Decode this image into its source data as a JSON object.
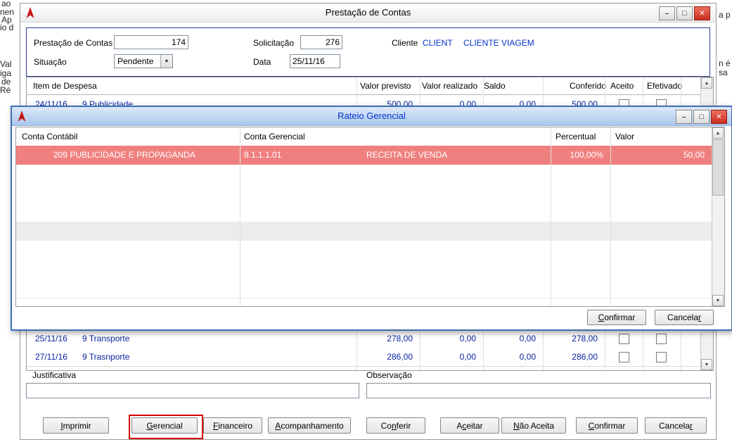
{
  "fragments": {
    "left": [
      "ao",
      "nen",
      "Ap",
      "io d",
      "Val",
      "iga",
      "de",
      "Ré"
    ],
    "right": [
      "a p",
      "n é",
      "sa"
    ]
  },
  "main_window": {
    "title": "Prestação de Contas",
    "form": {
      "prestacao_label": "Prestação de Contas",
      "prestacao_value": "174",
      "solicitacao_label": "Solicitação",
      "solicitacao_value": "276",
      "cliente_label": "Cliente",
      "cliente_code": "CLIENT",
      "cliente_name": "CLIENTE VIAGEM",
      "situacao_label": "Situação",
      "situacao_value": "Pendente",
      "data_label": "Data",
      "data_value": "25/11/16"
    },
    "table": {
      "headers": [
        "Item de Despesa",
        "Valor previsto",
        "Valor realizado",
        "Saldo",
        "Conferido",
        "Aceito",
        "Efetivado"
      ],
      "partial_row": {
        "date": "24/11/16",
        "item": "9 Publicidade",
        "previsto": "500,00",
        "realizado": "0,00",
        "saldo": "0,00",
        "conferido": "500,00"
      },
      "rows": [
        {
          "date": "25/11/16",
          "item": "9 Transporte",
          "previsto": "278,00",
          "realizado": "0,00",
          "saldo": "0,00",
          "conferido": "278,00",
          "aceito": false,
          "efetivado": false
        },
        {
          "date": "27/11/16",
          "item": "9 Trasnporte",
          "previsto": "286,00",
          "realizado": "0,00",
          "saldo": "0,00",
          "conferido": "286,00",
          "aceito": false,
          "efetivado": false
        }
      ]
    },
    "justificativa_label": "Justificativa",
    "justificativa_value": "",
    "observacao_label": "Observação",
    "observacao_value": "",
    "buttons": [
      {
        "label": "Imprimir",
        "u": 0
      },
      {
        "label": "Gerencial",
        "u": 0,
        "highlighted": true
      },
      {
        "label": "Financeiro",
        "u": 0
      },
      {
        "label": "Acompanhamento",
        "u": 0
      },
      {
        "label": "Conferir",
        "u": 2
      },
      {
        "label": "Aceitar",
        "u": 1
      },
      {
        "label": "Não Aceita",
        "u": 0
      },
      {
        "label": "Confirmar",
        "u": 0
      },
      {
        "label": "Cancelar",
        "u": 7
      }
    ]
  },
  "modal": {
    "title": "Rateio Gerencial",
    "table": {
      "headers": [
        "Conta Contábil",
        "Conta Gerencial",
        "Percentual",
        "Valor"
      ],
      "rows": [
        {
          "conta_contabil": "209  PUBLICIDADE E PROPAGANDA",
          "conta_gerencial_code": "8.1.1.1.01",
          "conta_gerencial_name": "RECEITA DE VENDA",
          "percentual": "100,00%",
          "valor": "50,00",
          "selected": true
        }
      ]
    },
    "buttons": [
      {
        "label": "Confirmar",
        "u": 0
      },
      {
        "label": "Cancelar",
        "u": 7
      }
    ]
  },
  "colors": {
    "row_text": "#0a23a0",
    "selected_row_bg": "#f08080",
    "selected_row_text": "#ffffff",
    "link_blue": "#0633cc",
    "highlight_outline": "#d40000",
    "modal_border": "#3f6fb5"
  }
}
